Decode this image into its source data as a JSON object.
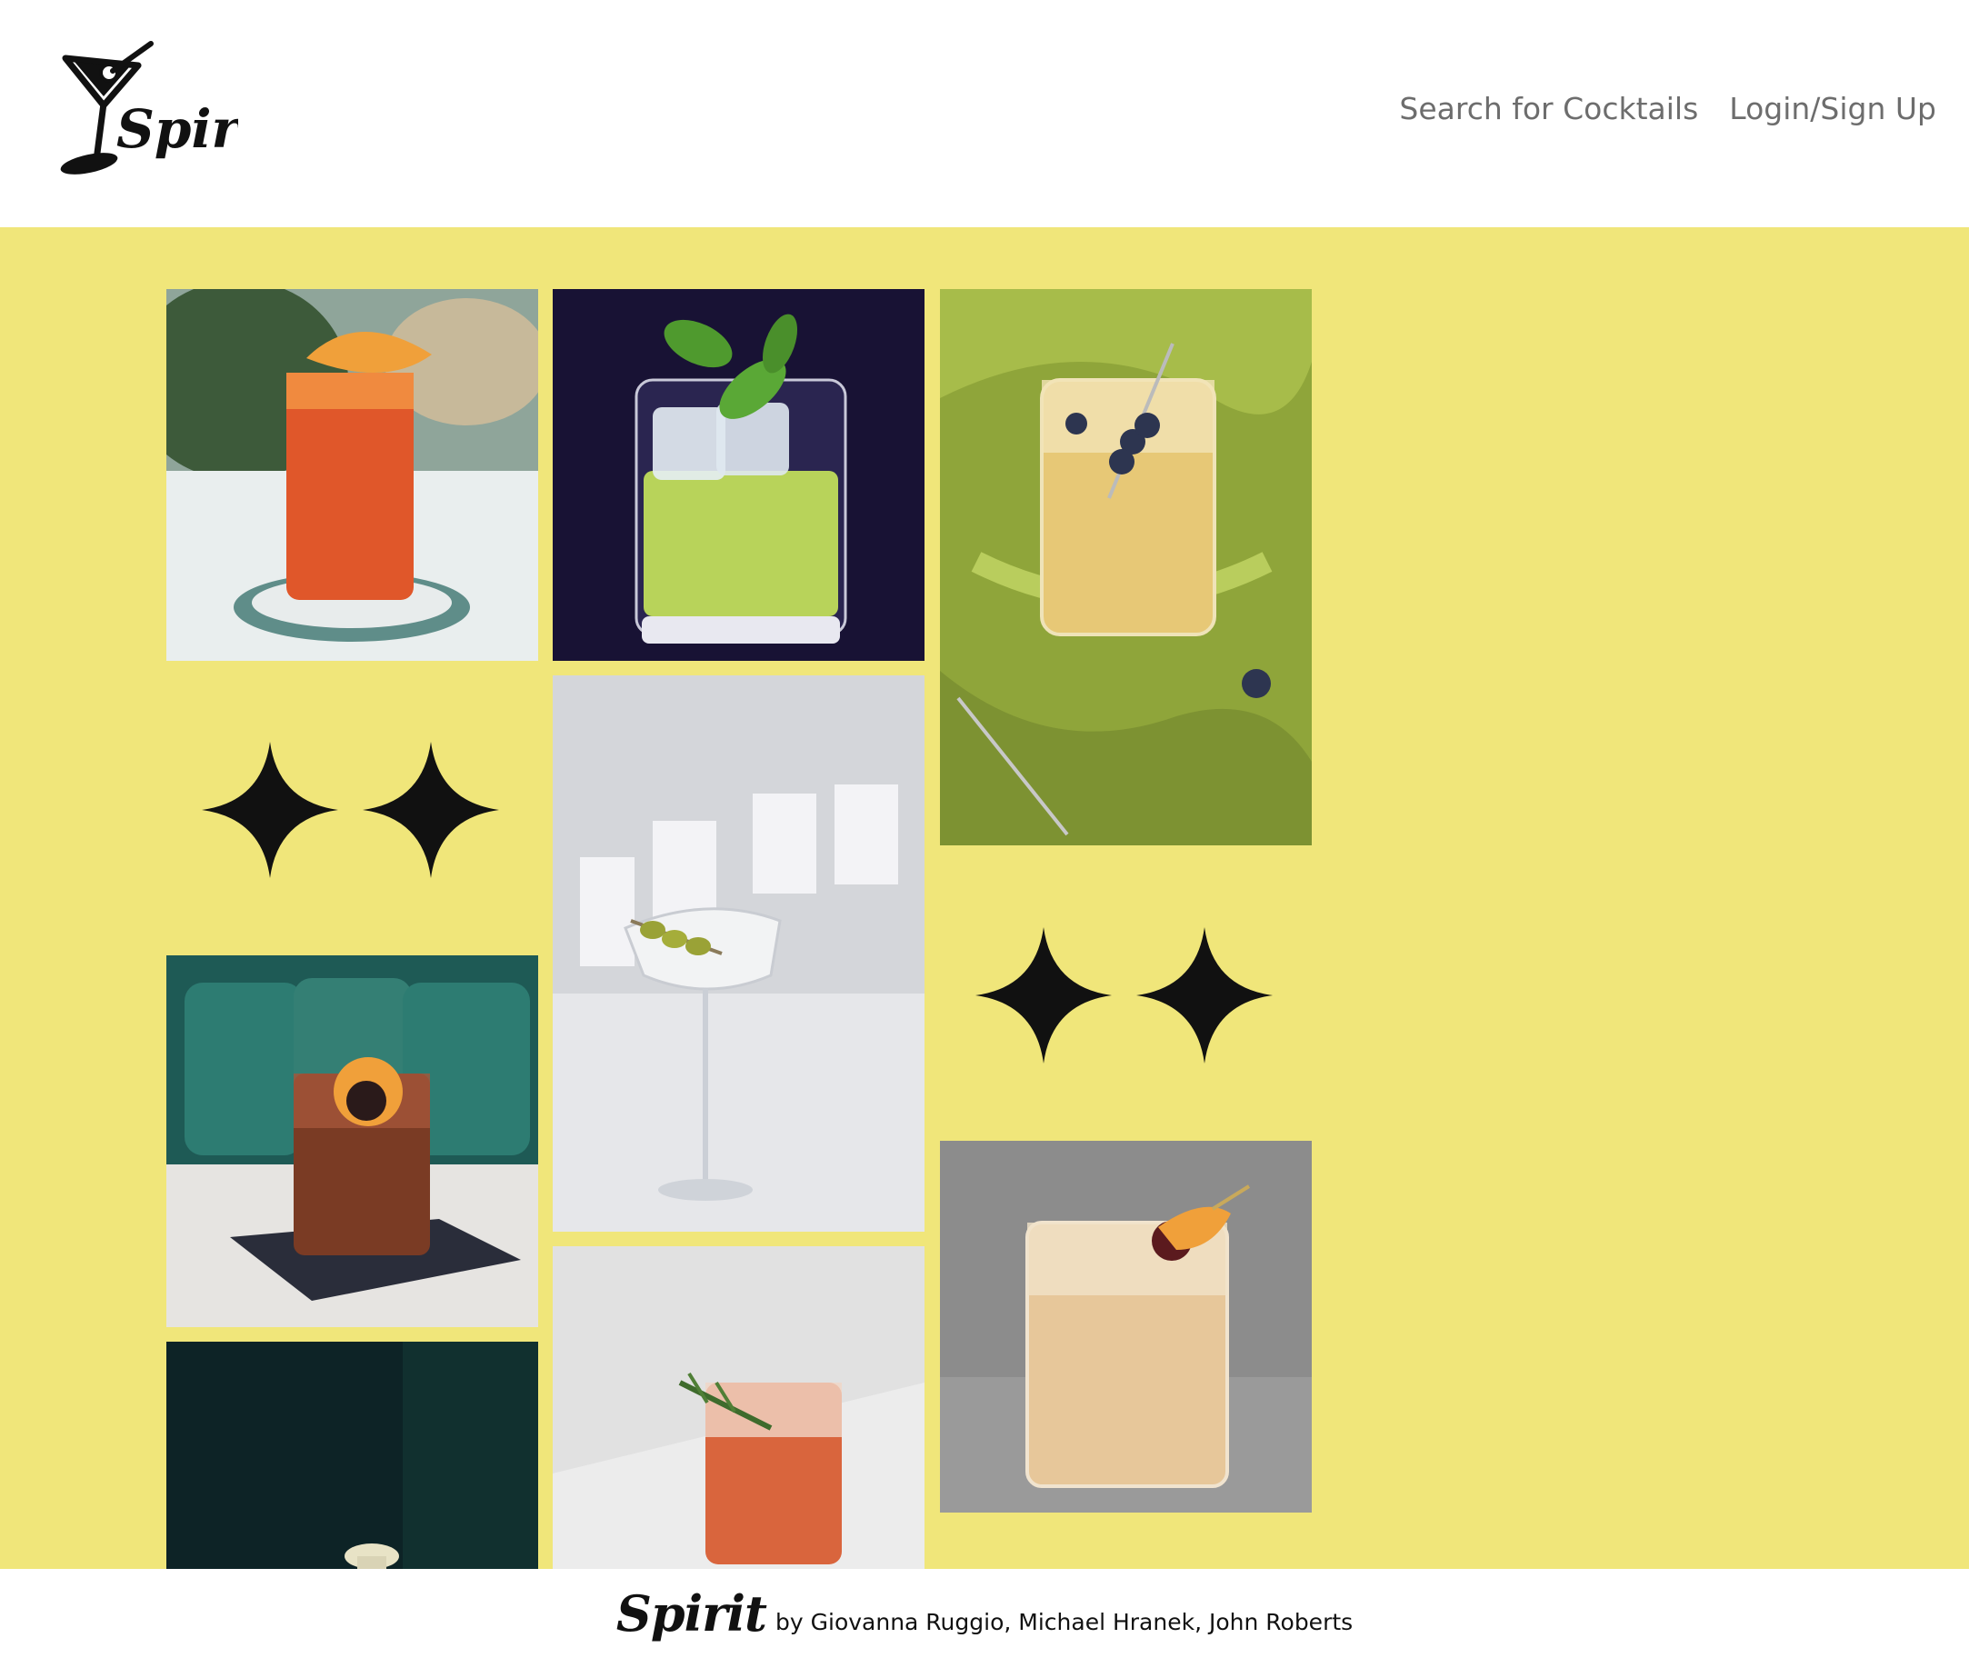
{
  "brand": {
    "name": "Spirit",
    "logo_icon": "martini-glass-icon"
  },
  "nav": {
    "search_label": "Search for Cocktails",
    "login_label": "Login/Sign Up"
  },
  "gallery": {
    "tiles": [
      {
        "name": "orange-highball-cocktail"
      },
      {
        "name": "basil-gimlet-cocktail"
      },
      {
        "name": "blueberry-highball-cocktail"
      },
      {
        "name": "olive-martini-cocktail"
      },
      {
        "name": "cherry-old-fashioned-cocktail"
      },
      {
        "name": "rosemary-negroni-cocktail"
      },
      {
        "name": "whiskey-sour-cocktail"
      },
      {
        "name": "dark-coupe-cocktail"
      }
    ],
    "decor_icon": "sparkle-stars-icon"
  },
  "footer": {
    "brand": "Spirit",
    "credit": "by Giovanna Ruggio, Michael Hranek, John Roberts"
  },
  "colors": {
    "background": "#f0e67a",
    "header": "#ffffff",
    "nav_text": "#6d6d6d",
    "ink": "#111111"
  }
}
